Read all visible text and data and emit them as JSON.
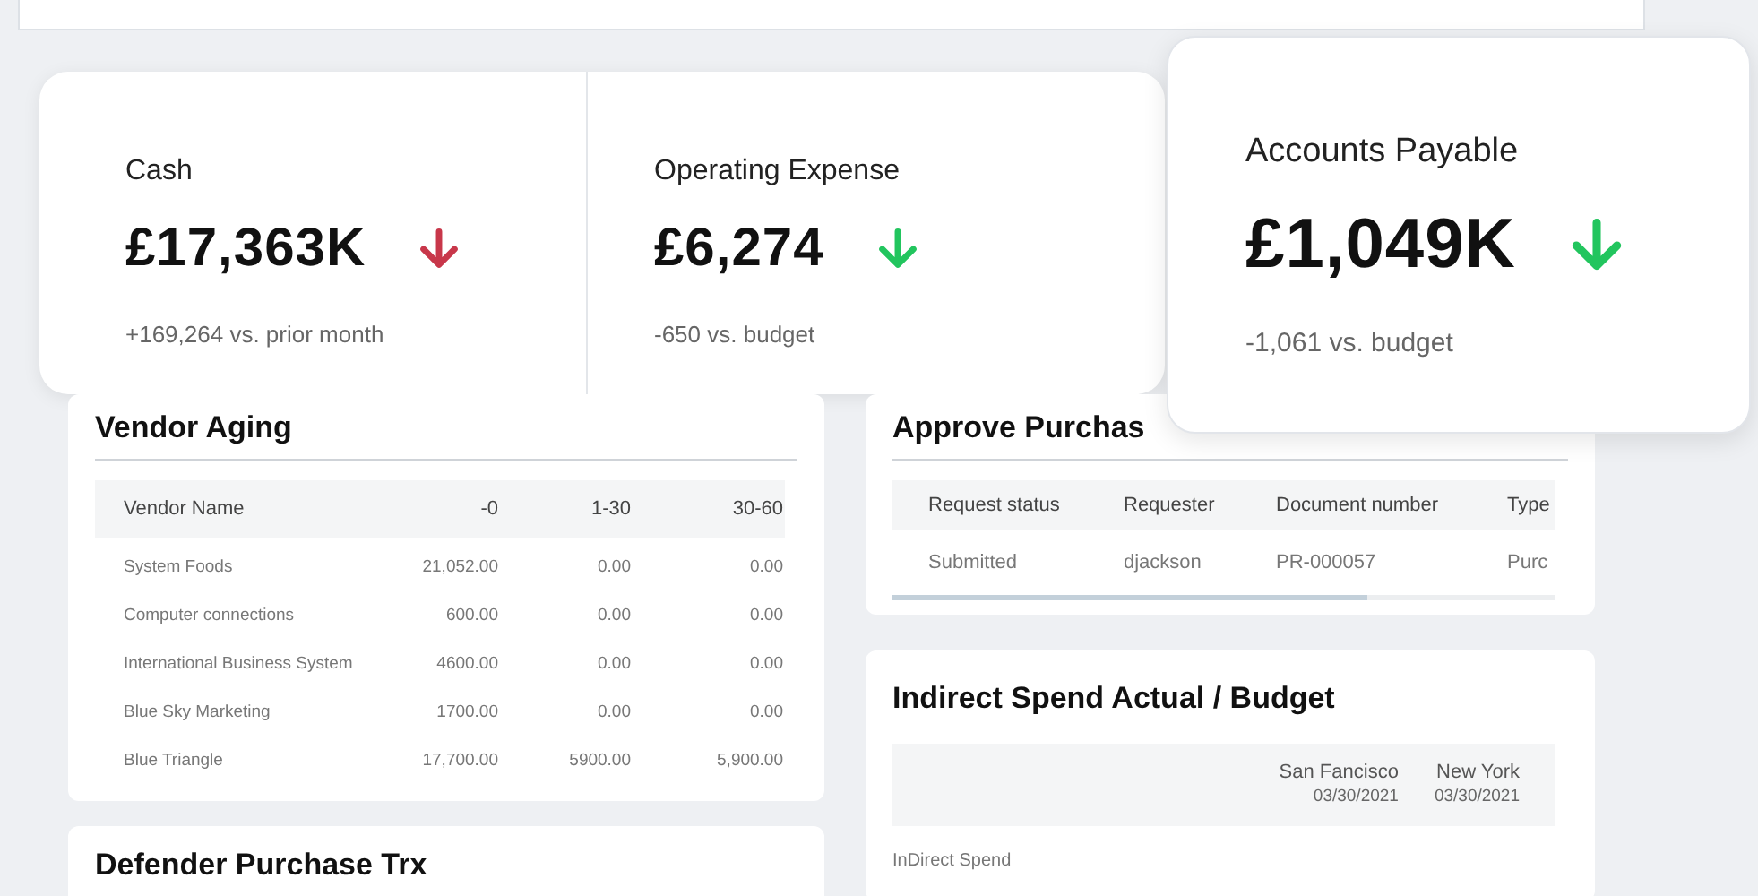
{
  "kpi_panel": {
    "items": [
      {
        "label": "Cash",
        "value": "£17,363K",
        "down": true,
        "color": "#c8374a",
        "comparison": "+169,264 vs. prior month"
      },
      {
        "label": "Operating Expense",
        "value": "£6,274",
        "down": true,
        "color": "#22c55e",
        "comparison": "-650 vs. budget"
      }
    ]
  },
  "highlight_kpi": {
    "label": "Accounts Payable",
    "value": "£1,049K",
    "down": true,
    "color": "#22c55e",
    "comparison": "-1,061 vs. budget"
  },
  "vendor_aging": {
    "title": "Vendor Aging",
    "columns": [
      "Vendor Name",
      "-0",
      "1-30",
      "30-60"
    ],
    "rows": [
      [
        "System Foods",
        "21,052.00",
        "0.00",
        "0.00"
      ],
      [
        "Computer connections",
        "600.00",
        "0.00",
        "0.00"
      ],
      [
        "International Business System",
        "4600.00",
        "0.00",
        "0.00"
      ],
      [
        "Blue Sky Marketing",
        "1700.00",
        "0.00",
        "0.00"
      ],
      [
        "Blue Triangle",
        "17,700.00",
        "5900.00",
        "5,900.00"
      ]
    ]
  },
  "defender_purchase": {
    "title": "Defender Purchase Trx"
  },
  "approve_purchasing": {
    "title": "Approve Purchas",
    "columns": [
      "Request status",
      "Requester",
      "Document number",
      "Type"
    ],
    "rows": [
      [
        "Submitted",
        "djackson",
        "PR-000057",
        "Purc"
      ]
    ]
  },
  "indirect_spend": {
    "title": "Indirect Spend Actual / Budget",
    "columns": [
      {
        "name": "San Fancisco",
        "date": "03/30/2021"
      },
      {
        "name": "New York",
        "date": "03/30/2021"
      }
    ],
    "row_label": "InDirect Spend"
  }
}
